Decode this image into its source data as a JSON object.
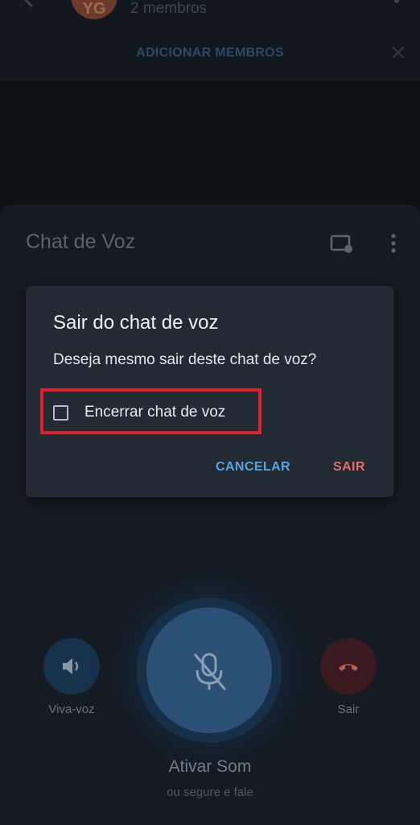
{
  "background": {
    "member_count": "2 membros",
    "add_members_label": "ADICIONAR MEMBROS",
    "avatar_initials": "YG"
  },
  "voice_panel": {
    "title": "Chat de Voz"
  },
  "controls": {
    "speaker_label": "Viva-voz",
    "leave_label": "Sair",
    "unmute_label": "Ativar Som",
    "unmute_hint": "ou segure e fale"
  },
  "dialog": {
    "title": "Sair do chat de voz",
    "message": "Deseja mesmo sair deste chat de voz?",
    "checkbox_label": "Encerrar chat de voz",
    "checkbox_checked": false,
    "cancel_label": "CANCELAR",
    "confirm_label": "SAIR"
  },
  "colors": {
    "highlight": "#e0202e",
    "cancel": "#5ba4e0",
    "confirm": "#e86a6a",
    "dialog_bg": "#222b34"
  },
  "icons": [
    "back-arrow-icon",
    "more-vertical-icon",
    "close-icon",
    "screen-share-icon",
    "speaker-icon",
    "mic-off-icon",
    "phone-hangup-icon"
  ]
}
